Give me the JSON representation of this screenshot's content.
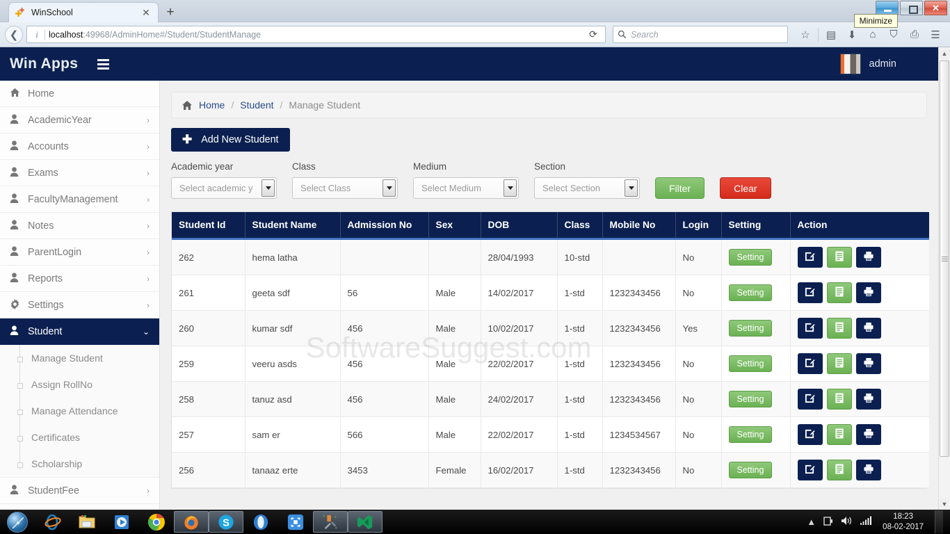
{
  "browser": {
    "tab_title": "WinSchool",
    "tab_close": "✕",
    "newtab_label": "+",
    "url_host": "localhost",
    "url_rest": ":49968/AdminHome#/Student/StudentManage",
    "search_placeholder": "Search",
    "back_icon": "❮",
    "info_icon": "i",
    "reload_icon": "⟳",
    "search_icon": "⚲",
    "tooltip": "Minimize",
    "icons": {
      "bookmark": "☆",
      "library": "▤",
      "downloads": "⬇",
      "home": "⌂",
      "pocket": "⛉",
      "print": "⎙",
      "menu": "☰"
    }
  },
  "app": {
    "brand": "Win Apps",
    "menu_toggle": "hamburger-icon",
    "user": "admin"
  },
  "sidebar": {
    "items": [
      {
        "label": "Home",
        "icon": "home-icon",
        "caret": "",
        "active": false
      },
      {
        "label": "AcademicYear",
        "icon": "user-icon",
        "caret": "›",
        "active": false
      },
      {
        "label": "Accounts",
        "icon": "user-icon",
        "caret": "›",
        "active": false
      },
      {
        "label": "Exams",
        "icon": "user-icon",
        "caret": "›",
        "active": false
      },
      {
        "label": "FacultyManagement",
        "icon": "user-icon",
        "caret": "›",
        "active": false
      },
      {
        "label": "Notes",
        "icon": "user-icon",
        "caret": "›",
        "active": false
      },
      {
        "label": "ParentLogin",
        "icon": "user-icon",
        "caret": "›",
        "active": false
      },
      {
        "label": "Reports",
        "icon": "user-icon",
        "caret": "›",
        "active": false
      },
      {
        "label": "Settings",
        "icon": "gear-icon",
        "caret": "›",
        "active": false
      },
      {
        "label": "Student",
        "icon": "user-icon",
        "caret": "⌄",
        "active": true
      }
    ],
    "sub_items": [
      {
        "label": "Manage Student"
      },
      {
        "label": "Assign RollNo"
      },
      {
        "label": "Manage Attendance"
      },
      {
        "label": "Certificates"
      },
      {
        "label": "Scholarship"
      }
    ],
    "items_after": [
      {
        "label": "StudentFee",
        "icon": "user-icon",
        "caret": "›",
        "active": false
      }
    ]
  },
  "breadcrumb": {
    "home": "Home",
    "sep": "/",
    "section": "Student",
    "current": "Manage Student"
  },
  "toolbar": {
    "add_new_label": "Add New Student",
    "add_new_plus": "✚"
  },
  "filters": {
    "fields": [
      {
        "label": "Academic year",
        "value": "Select academic y"
      },
      {
        "label": "Class",
        "value": "Select Class"
      },
      {
        "label": "Medium",
        "value": "Select Medium"
      },
      {
        "label": "Section",
        "value": "Select Section"
      }
    ],
    "filter_label": "Filter",
    "clear_label": "Clear"
  },
  "table": {
    "columns": [
      "Student Id",
      "Student Name",
      "Admission No",
      "Sex",
      "DOB",
      "Class",
      "Mobile No",
      "Login",
      "Setting",
      "Action"
    ],
    "setting_label": "Setting",
    "action_icons": [
      "edit-icon",
      "list-icon",
      "print-icon"
    ],
    "rows": [
      {
        "id": "262",
        "name": "hema latha",
        "admission": "",
        "sex": "",
        "dob": "28/04/1993",
        "class": "10-std",
        "mobile": "",
        "login": "No"
      },
      {
        "id": "261",
        "name": "geeta sdf",
        "admission": "56",
        "sex": "Male",
        "dob": "14/02/2017",
        "class": "1-std",
        "mobile": "1232343456",
        "login": "No"
      },
      {
        "id": "260",
        "name": "kumar sdf",
        "admission": "456",
        "sex": "Male",
        "dob": "10/02/2017",
        "class": "1-std",
        "mobile": "1232343456",
        "login": "Yes"
      },
      {
        "id": "259",
        "name": "veeru asds",
        "admission": "456",
        "sex": "Male",
        "dob": "22/02/2017",
        "class": "1-std",
        "mobile": "1232343456",
        "login": "No"
      },
      {
        "id": "258",
        "name": "tanuz asd",
        "admission": "456",
        "sex": "Male",
        "dob": "24/02/2017",
        "class": "1-std",
        "mobile": "1232343456",
        "login": "No"
      },
      {
        "id": "257",
        "name": "sam er",
        "admission": "566",
        "sex": "Male",
        "dob": "22/02/2017",
        "class": "1-std",
        "mobile": "1234534567",
        "login": "No"
      },
      {
        "id": "256",
        "name": "tanaaz erte",
        "admission": "3453",
        "sex": "Female",
        "dob": "16/02/2017",
        "class": "1-std",
        "mobile": "1232343456",
        "login": "No"
      }
    ]
  },
  "watermark": {
    "bold": "SoftwareSuggest",
    "light": ".com"
  },
  "taskbar": {
    "start": "windows-start-orb",
    "apps": [
      "internet-explorer-icon",
      "file-explorer-icon",
      "media-player-icon",
      "chrome-icon",
      "firefox-icon",
      "skype-icon",
      "opera-icon",
      "screenshot-tool-icon",
      "tools-icon",
      "visual-studio-icon"
    ],
    "tray": {
      "up": "▲",
      "plug": "⌸",
      "volume": "🕪",
      "network": "▮"
    },
    "time": "18:23",
    "date": "08-02-2017"
  },
  "colors": {
    "navy": "#0b2050",
    "green": "#6bb153",
    "red": "#d52b1b",
    "link": "#274b8c"
  }
}
